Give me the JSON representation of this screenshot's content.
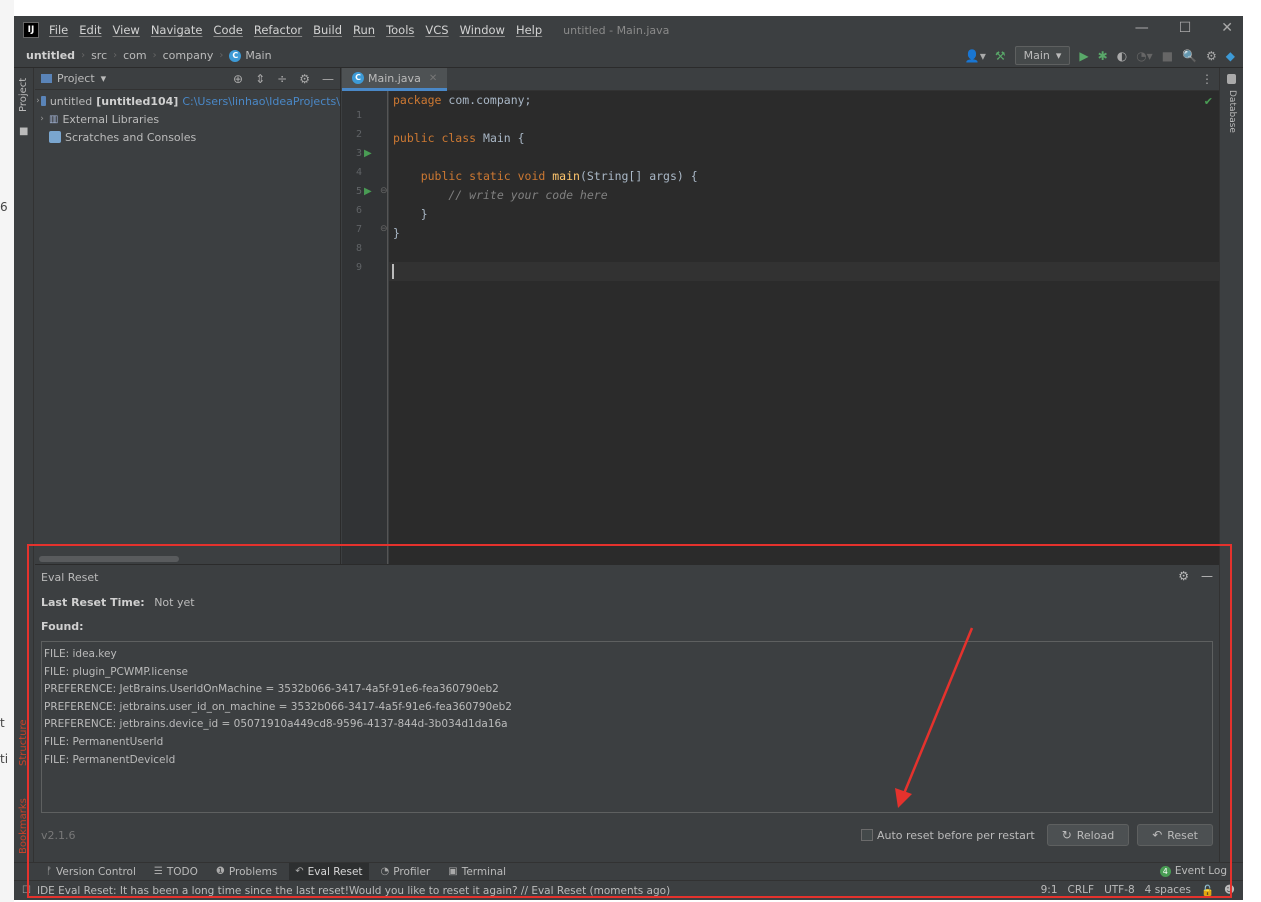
{
  "menu": {
    "items": [
      "File",
      "Edit",
      "View",
      "Navigate",
      "Code",
      "Refactor",
      "Build",
      "Run",
      "Tools",
      "VCS",
      "Window",
      "Help"
    ],
    "window_title": "untitled - Main.java"
  },
  "nav": {
    "breadcrumbs": [
      "untitled",
      "src",
      "com",
      "company",
      "Main"
    ],
    "run_config": "Main"
  },
  "project_pane": {
    "title": "Project",
    "stripe_label": "Project",
    "tree": {
      "root_name": "untitled",
      "root_module": "[untitled104]",
      "root_path": "C:\\Users\\linhao\\IdeaProjects\\",
      "external_libraries": "External Libraries",
      "scratches": "Scratches and Consoles"
    }
  },
  "editor": {
    "tab_label": "Main.java",
    "line_numbers": [
      "1",
      "2",
      "3",
      "4",
      "5",
      "6",
      "7",
      "8",
      "9"
    ],
    "code": {
      "l1_kw": "package",
      "l1_rest": " com.company;",
      "l3_kw": "public class",
      "l3_rest": " Main {",
      "l5_kw": "    public static void",
      "l5_fn": " main",
      "l5_rest": "(String[] args) {",
      "l6": "        // write your code here",
      "l7": "    }",
      "l8": "}"
    }
  },
  "right_stripe": {
    "database_label": "Database"
  },
  "left_stripe": {
    "structure_label": "Structure",
    "bookmarks_label": "Bookmarks"
  },
  "eval_reset": {
    "title": "Eval Reset",
    "last_reset_label": "Last Reset Time:",
    "last_reset_value": "Not yet",
    "found_label": "Found:",
    "found_items": [
      "FILE: idea.key",
      "FILE: plugin_PCWMP.license",
      "PREFERENCE: JetBrains.UserIdOnMachine = 3532b066-3417-4a5f-91e6-fea360790eb2",
      "PREFERENCE: jetbrains.user_id_on_machine = 3532b066-3417-4a5f-91e6-fea360790eb2",
      "PREFERENCE: jetbrains.device_id = 05071910a449cd8-9596-4137-844d-3b034d1da16a",
      "FILE: PermanentUserId",
      "FILE: PermanentDeviceId"
    ],
    "version": "v2.1.6",
    "auto_reset_label": "Auto reset before per restart",
    "reload_label": "Reload",
    "reset_label": "Reset"
  },
  "bottom_tabs": {
    "version_control": "Version Control",
    "todo": "TODO",
    "problems": "Problems",
    "eval_reset": "Eval Reset",
    "profiler": "Profiler",
    "terminal": "Terminal",
    "event_log": "Event Log",
    "event_count": "4"
  },
  "status": {
    "message": "IDE Eval Reset: It has been a long time since the last reset!Would you like to reset it again? // Eval Reset (moments ago)",
    "position": "9:1",
    "line_sep": "CRLF",
    "encoding": "UTF-8",
    "indent": "4 spaces"
  },
  "background_fragments": [
    "6",
    "t",
    "ti"
  ],
  "colors": {
    "annotation_red": "#e5322d",
    "keyword": "#cc7832",
    "function": "#ffc66d",
    "comment": "#808080",
    "run_green": "#59a869",
    "link_blue": "#4a88c7"
  }
}
